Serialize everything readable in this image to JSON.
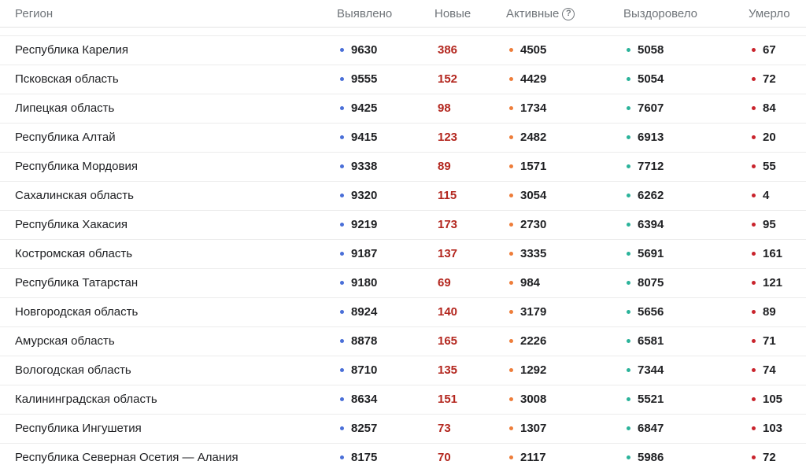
{
  "colors": {
    "confirmed": "#4a6fd8",
    "new": "#b3261e",
    "active": "#ee7d3a",
    "recovered": "#2bb39a",
    "deaths": "#c9232c"
  },
  "header": {
    "region": "Регион",
    "confirmed": "Выявлено",
    "new": "Новые",
    "active": "Активные",
    "active_help": "?",
    "recovered": "Выздоровело",
    "deaths": "Умерло"
  },
  "rows": [
    {
      "region": "Республика Карелия",
      "confirmed": "9630",
      "new": "386",
      "active": "4505",
      "recovered": "5058",
      "deaths": "67"
    },
    {
      "region": "Псковская область",
      "confirmed": "9555",
      "new": "152",
      "active": "4429",
      "recovered": "5054",
      "deaths": "72"
    },
    {
      "region": "Липецкая область",
      "confirmed": "9425",
      "new": "98",
      "active": "1734",
      "recovered": "7607",
      "deaths": "84"
    },
    {
      "region": "Республика Алтай",
      "confirmed": "9415",
      "new": "123",
      "active": "2482",
      "recovered": "6913",
      "deaths": "20"
    },
    {
      "region": "Республика Мордовия",
      "confirmed": "9338",
      "new": "89",
      "active": "1571",
      "recovered": "7712",
      "deaths": "55"
    },
    {
      "region": "Сахалинская область",
      "confirmed": "9320",
      "new": "115",
      "active": "3054",
      "recovered": "6262",
      "deaths": "4"
    },
    {
      "region": "Республика Хакасия",
      "confirmed": "9219",
      "new": "173",
      "active": "2730",
      "recovered": "6394",
      "deaths": "95"
    },
    {
      "region": "Костромская область",
      "confirmed": "9187",
      "new": "137",
      "active": "3335",
      "recovered": "5691",
      "deaths": "161"
    },
    {
      "region": "Республика Татарстан",
      "confirmed": "9180",
      "new": "69",
      "active": "984",
      "recovered": "8075",
      "deaths": "121"
    },
    {
      "region": "Новгородская область",
      "confirmed": "8924",
      "new": "140",
      "active": "3179",
      "recovered": "5656",
      "deaths": "89"
    },
    {
      "region": "Амурская область",
      "confirmed": "8878",
      "new": "165",
      "active": "2226",
      "recovered": "6581",
      "deaths": "71"
    },
    {
      "region": "Вологодская область",
      "confirmed": "8710",
      "new": "135",
      "active": "1292",
      "recovered": "7344",
      "deaths": "74"
    },
    {
      "region": "Калининградская область",
      "confirmed": "8634",
      "new": "151",
      "active": "3008",
      "recovered": "5521",
      "deaths": "105"
    },
    {
      "region": "Республика Ингушетия",
      "confirmed": "8257",
      "new": "73",
      "active": "1307",
      "recovered": "6847",
      "deaths": "103"
    },
    {
      "region": "Республика Северная Осетия — Алания",
      "confirmed": "8175",
      "new": "70",
      "active": "2117",
      "recovered": "5986",
      "deaths": "72"
    }
  ]
}
